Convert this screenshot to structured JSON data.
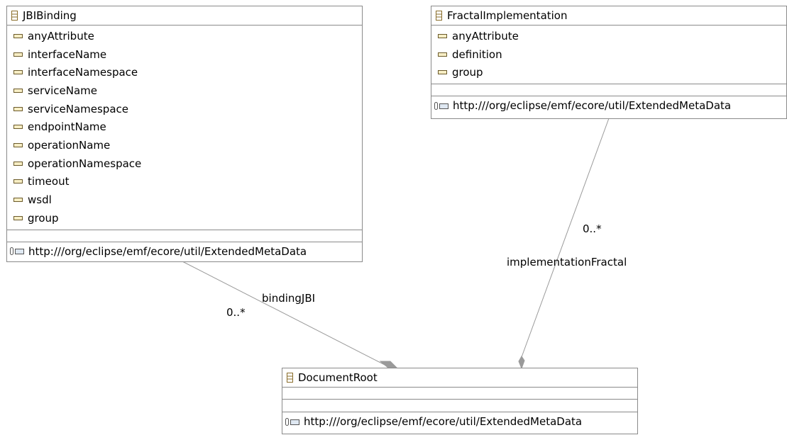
{
  "classes": {
    "jbi": {
      "name": "JBIBinding",
      "attributes": [
        "anyAttribute",
        "interfaceName",
        "interfaceNamespace",
        "serviceName",
        "serviceNamespace",
        "endpointName",
        "operationName",
        "operationNamespace",
        "timeout",
        "wsdl",
        "group"
      ],
      "annotation": "http:///org/eclipse/emf/ecore/util/ExtendedMetaData"
    },
    "fractal": {
      "name": "FractalImplementation",
      "attributes": [
        "anyAttribute",
        "definition",
        "group"
      ],
      "annotation": "http:///org/eclipse/emf/ecore/util/ExtendedMetaData"
    },
    "root": {
      "name": "DocumentRoot",
      "annotation": "http:///org/eclipse/emf/ecore/util/ExtendedMetaData"
    }
  },
  "edges": {
    "binding": {
      "role": "bindingJBI",
      "multiplicity": "0..*"
    },
    "implementation": {
      "role": "implementationFractal",
      "multiplicity": "0..*"
    }
  }
}
